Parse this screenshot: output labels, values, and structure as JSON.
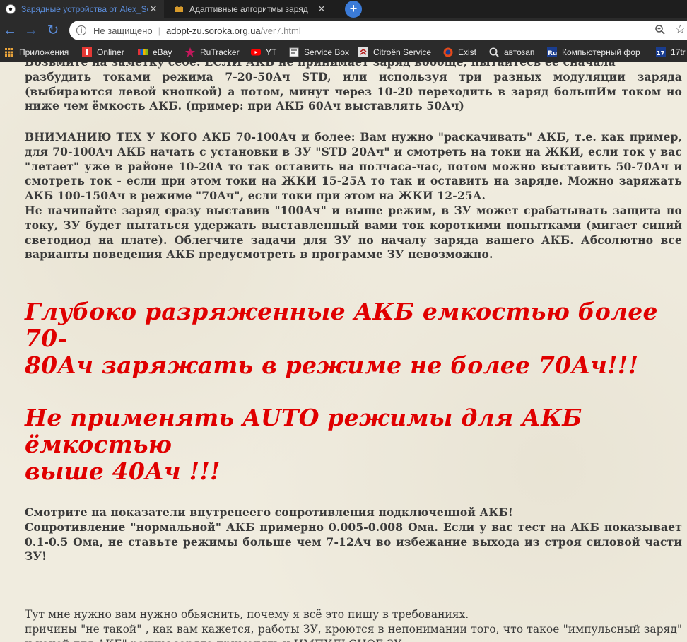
{
  "browser": {
    "tabs": [
      {
        "title": "Зарядные устройства от Alex_So",
        "close": "✕"
      },
      {
        "title": "Адаптивные алгоритмы заряд",
        "close": "✕"
      }
    ],
    "new_tab": "+",
    "nav": {
      "back": "←",
      "forward": "→",
      "reload": "↻"
    },
    "address": {
      "security_label": "Не защищено",
      "separator": "|",
      "host": "adopt-zu.soroka.org.ua",
      "path": "/ver7.html"
    },
    "bookmarks": [
      {
        "label": "Приложения",
        "icon": "apps-grid-icon",
        "color": "#e8a33b"
      },
      {
        "label": "Onliner",
        "icon": "onliner-icon",
        "color": "#e53935"
      },
      {
        "label": "eBay",
        "icon": "ebay-icon",
        "color": "#f5c518"
      },
      {
        "label": "RuTracker",
        "icon": "rutracker-icon",
        "color": "#c2185b"
      },
      {
        "label": "YT",
        "icon": "youtube-icon",
        "color": "#ff0000"
      },
      {
        "label": "Service Box",
        "icon": "service-box-icon",
        "color": "#d0d0d0"
      },
      {
        "label": "Citroën Service",
        "icon": "citroen-icon",
        "color": "#d0d0d0"
      },
      {
        "label": "Exist",
        "icon": "exist-icon",
        "color": "#e64a19"
      },
      {
        "label": "автозап",
        "icon": "autozap-icon",
        "color": "#d0d0d0"
      },
      {
        "label": "Компьютерный фор",
        "icon": "ru-board-icon",
        "color": "#1a3d8f"
      },
      {
        "label": "17tr",
        "icon": "17tr-icon",
        "color": "#1a3d8f"
      }
    ]
  },
  "article": {
    "p1_top": "Возьмите на заметку себе: ЕСЛИ АКБ не принимает заряд вообще, пытайтесь ее сначала",
    "p1_body": "разбудить токами режима 7-20-50Ач STD, или используя три разных модуляции заряда (выбираются левой кнопкой) а потом, минут через 10-20 переходить в заряд большИм током но ниже чем ёмкость АКБ. (пример: при АКБ 60Ач выставлять 50Ач)",
    "p2": "ВНИМАНИЮ ТЕХ У КОГО АКБ 70-100Ач и более: Вам нужно \"раскачивать\" АКБ, т.е. как пример, для 70-100Ач АКБ начать с установки в ЗУ \"STD 20Ач\" и смотреть на токи на ЖКИ, если ток у вас \"летает\" уже в районе 10-20А то так оставить на полчаса-час, потом можно выставить 50-70Ач и смотреть ток - если при этом токи на ЖКИ 15-25А то так и оставить на заряде. Можно заряжать АКБ 100-150Ач в режиме \"70Ач\", если токи при этом на ЖКИ 12-25А.",
    "p3": "Не начинайте заряд сразу выставив \"100Ач\" и выше режим, в ЗУ может срабатывать защита по току, ЗУ будет пытаться удержать выставленный вами ток короткими попытками (мигает синий светодиод на плате). Облегчите задачи для ЗУ по началу заряда вашего АКБ. Абсолютно все варианты поведения АКБ предусмотреть в программе ЗУ невозможно.",
    "warn1_line1": "Глубоко разряженные АКБ емкостью более 70-",
    "warn1_line2": "80Ач заряжать в режиме не более 70Ач!!!",
    "warn2_line1": "Не применять AUTO режимы для АКБ ёмкостью",
    "warn2_line2": "выше 40Ач !!!",
    "p4_line1": "Смотрите на показатели внутренеего сопротивления подключенной АКБ!",
    "p4_rest": "Сопротивление \"нормальной\" АКБ примерно 0.005-0.008 Ома. Если у вас тест на АКБ показывает 0.1-0.5 Ома, не ставьте режимы больше чем 7-12Ач во избежание выхода из строя силовой части ЗУ!",
    "p5_line1": "Тут мне нужно вам нужно обьяснить, почему я всё это пишу в требованиях.",
    "p5_rest": "причины \"не такой\" , как вам кажется, работы ЗУ, кроются в непонимании того, что такое \"импульсный заряд\" и какой для АКБ\" режим заряда применять и ИМПУЛЬСНОЕ ЗУ"
  },
  "colors": {
    "warning_red": "#e00000",
    "body_text": "#3a3a3a",
    "page_bg": "#f0ecdf",
    "link_blue": "#5b8ddb"
  }
}
